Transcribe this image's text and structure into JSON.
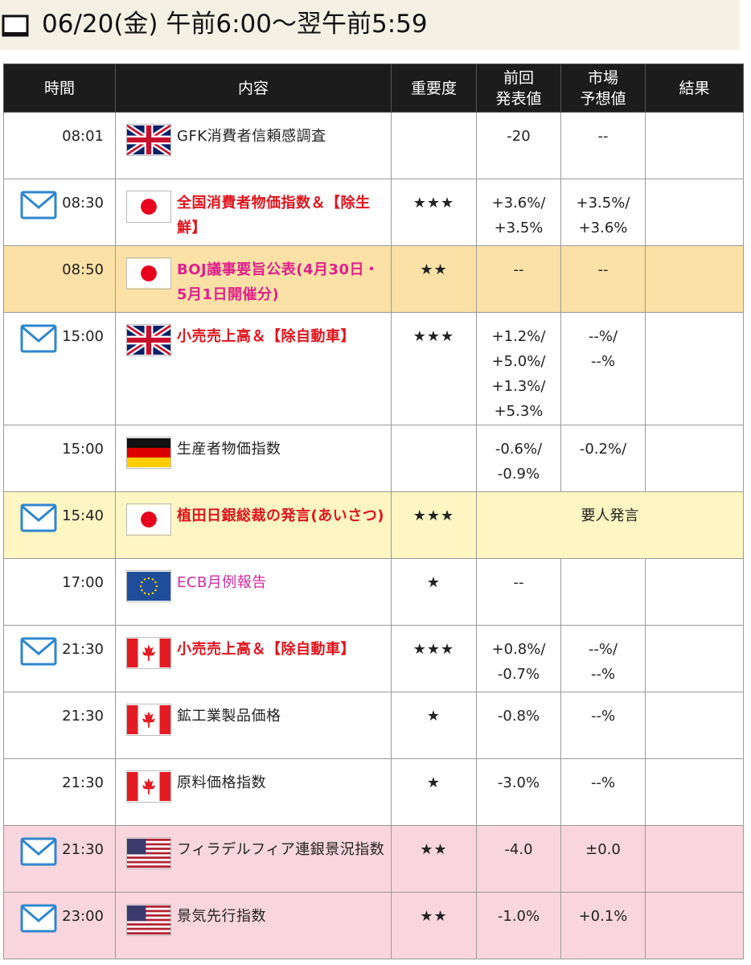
{
  "header": {
    "date_text": "06/20(金)  午前6:00〜翌午前5:59"
  },
  "columns": [
    "時間",
    "内容",
    "重要度",
    "前回\n発表値",
    "市場\n予想値",
    "結果"
  ],
  "rows": [
    {
      "time": "08:01",
      "flag": "uk",
      "name": "GFK消費者信頼感調査",
      "style": "plain",
      "stars": "",
      "prev": [
        "-20"
      ],
      "forecast": [
        "--"
      ],
      "result": "",
      "mail": false,
      "highlight": ""
    },
    {
      "time": "08:30",
      "flag": "jp",
      "name": "全国消費者物価指数＆【除生鮮】",
      "style": "red",
      "stars": "★★★",
      "prev": [
        "+3.6%/",
        "+3.5%"
      ],
      "forecast": [
        "+3.5%/",
        "+3.6%"
      ],
      "result": "",
      "mail": true,
      "highlight": ""
    },
    {
      "time": "08:50",
      "flag": "jp",
      "name": "BOJ議事要旨公表(4月30日・5月1日開催分)",
      "style": "pink",
      "stars": "★★",
      "prev": [
        "--"
      ],
      "forecast": [
        "--"
      ],
      "result": "",
      "mail": false,
      "highlight": "orange"
    },
    {
      "time": "15:00",
      "flag": "uk",
      "name": "小売売上高＆【除自動車】",
      "style": "red",
      "stars": "★★★",
      "prev": [
        "+1.2%/",
        "+5.0%/",
        "+1.3%/",
        "+5.3%"
      ],
      "forecast": [
        "--%/",
        "--%"
      ],
      "result": "",
      "mail": true,
      "highlight": ""
    },
    {
      "time": "15:00",
      "flag": "de",
      "name": "生産者物価指数",
      "style": "plain",
      "stars": "",
      "prev": [
        "-0.6%/",
        "-0.9%"
      ],
      "forecast": [
        "-0.2%/"
      ],
      "result": "",
      "mail": false,
      "highlight": ""
    },
    {
      "time": "15:40",
      "flag": "jp",
      "name": "植田日銀総裁の発言(あいさつ)",
      "style": "red",
      "stars": "★★★",
      "merged": "要人発言",
      "mail": true,
      "highlight": "yellow"
    },
    {
      "time": "17:00",
      "flag": "eu",
      "name": "ECB月例報告",
      "style": "magenta",
      "stars": "★",
      "prev": [
        "--"
      ],
      "forecast": [
        ""
      ],
      "result": "",
      "mail": false,
      "highlight": ""
    },
    {
      "time": "21:30",
      "flag": "ca",
      "name": "小売売上高＆【除自動車】",
      "style": "red",
      "stars": "★★★",
      "prev": [
        "+0.8%/",
        "-0.7%"
      ],
      "forecast": [
        "--%/",
        "--%"
      ],
      "result": "",
      "mail": true,
      "highlight": ""
    },
    {
      "time": "21:30",
      "flag": "ca",
      "name": "鉱工業製品価格",
      "style": "plain",
      "stars": "★",
      "prev": [
        "-0.8%"
      ],
      "forecast": [
        "--%"
      ],
      "result": "",
      "mail": false,
      "highlight": ""
    },
    {
      "time": "21:30",
      "flag": "ca",
      "name": "原料価格指数",
      "style": "plain",
      "stars": "★",
      "prev": [
        "-3.0%"
      ],
      "forecast": [
        "--%"
      ],
      "result": "",
      "mail": false,
      "highlight": ""
    },
    {
      "time": "21:30",
      "flag": "us",
      "name": "フィラデルフィア連銀景況指数",
      "style": "plain",
      "stars": "★★",
      "prev": [
        "-4.0"
      ],
      "forecast": [
        "±0.0"
      ],
      "result": "",
      "mail": true,
      "highlight": "pink"
    },
    {
      "time": "23:00",
      "flag": "us",
      "name": "景気先行指数",
      "style": "plain",
      "stars": "★★",
      "prev": [
        "-1.0%"
      ],
      "forecast": [
        "+0.1%"
      ],
      "result": "",
      "mail": true,
      "highlight": "pink"
    }
  ],
  "row_heights": [
    83,
    83,
    83,
    140,
    83,
    83,
    83,
    83,
    83,
    83,
    83,
    83
  ],
  "icons": {
    "header": "tv-icon",
    "alert": "mail-icon",
    "flags": [
      "uk-flag-icon",
      "jp-flag-icon",
      "de-flag-icon",
      "eu-flag-icon",
      "ca-flag-icon",
      "us-flag-icon"
    ]
  },
  "colors": {
    "red_event": "#e0141c",
    "pink_event": "#e0208c",
    "header_bg": "#1c1c1c",
    "highlight_orange": "#fbe1a6",
    "highlight_yellow": "#fdf6c2",
    "highlight_pink": "#f9d6dd"
  }
}
